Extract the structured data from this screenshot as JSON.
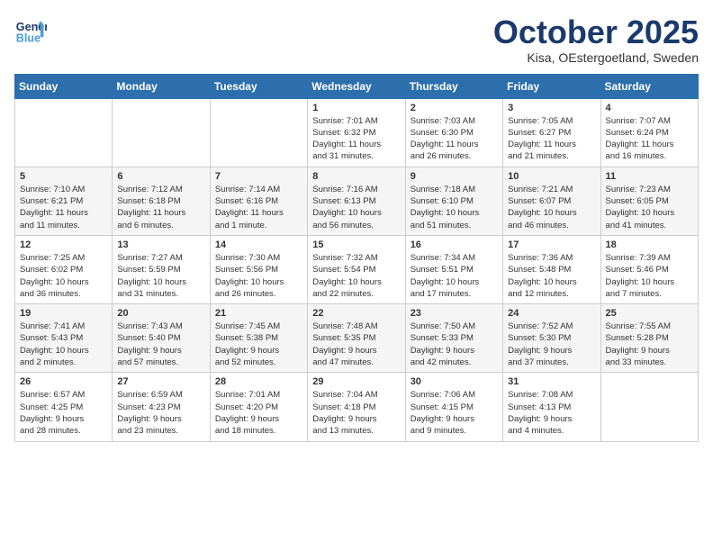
{
  "header": {
    "logo_line1": "General",
    "logo_line2": "Blue",
    "month": "October 2025",
    "location": "Kisa, OEstergoetland, Sweden"
  },
  "weekdays": [
    "Sunday",
    "Monday",
    "Tuesday",
    "Wednesday",
    "Thursday",
    "Friday",
    "Saturday"
  ],
  "weeks": [
    [
      {
        "day": "",
        "info": ""
      },
      {
        "day": "",
        "info": ""
      },
      {
        "day": "",
        "info": ""
      },
      {
        "day": "1",
        "info": "Sunrise: 7:01 AM\nSunset: 6:32 PM\nDaylight: 11 hours\nand 31 minutes."
      },
      {
        "day": "2",
        "info": "Sunrise: 7:03 AM\nSunset: 6:30 PM\nDaylight: 11 hours\nand 26 minutes."
      },
      {
        "day": "3",
        "info": "Sunrise: 7:05 AM\nSunset: 6:27 PM\nDaylight: 11 hours\nand 21 minutes."
      },
      {
        "day": "4",
        "info": "Sunrise: 7:07 AM\nSunset: 6:24 PM\nDaylight: 11 hours\nand 16 minutes."
      }
    ],
    [
      {
        "day": "5",
        "info": "Sunrise: 7:10 AM\nSunset: 6:21 PM\nDaylight: 11 hours\nand 11 minutes."
      },
      {
        "day": "6",
        "info": "Sunrise: 7:12 AM\nSunset: 6:18 PM\nDaylight: 11 hours\nand 6 minutes."
      },
      {
        "day": "7",
        "info": "Sunrise: 7:14 AM\nSunset: 6:16 PM\nDaylight: 11 hours\nand 1 minute."
      },
      {
        "day": "8",
        "info": "Sunrise: 7:16 AM\nSunset: 6:13 PM\nDaylight: 10 hours\nand 56 minutes."
      },
      {
        "day": "9",
        "info": "Sunrise: 7:18 AM\nSunset: 6:10 PM\nDaylight: 10 hours\nand 51 minutes."
      },
      {
        "day": "10",
        "info": "Sunrise: 7:21 AM\nSunset: 6:07 PM\nDaylight: 10 hours\nand 46 minutes."
      },
      {
        "day": "11",
        "info": "Sunrise: 7:23 AM\nSunset: 6:05 PM\nDaylight: 10 hours\nand 41 minutes."
      }
    ],
    [
      {
        "day": "12",
        "info": "Sunrise: 7:25 AM\nSunset: 6:02 PM\nDaylight: 10 hours\nand 36 minutes."
      },
      {
        "day": "13",
        "info": "Sunrise: 7:27 AM\nSunset: 5:59 PM\nDaylight: 10 hours\nand 31 minutes."
      },
      {
        "day": "14",
        "info": "Sunrise: 7:30 AM\nSunset: 5:56 PM\nDaylight: 10 hours\nand 26 minutes."
      },
      {
        "day": "15",
        "info": "Sunrise: 7:32 AM\nSunset: 5:54 PM\nDaylight: 10 hours\nand 22 minutes."
      },
      {
        "day": "16",
        "info": "Sunrise: 7:34 AM\nSunset: 5:51 PM\nDaylight: 10 hours\nand 17 minutes."
      },
      {
        "day": "17",
        "info": "Sunrise: 7:36 AM\nSunset: 5:48 PM\nDaylight: 10 hours\nand 12 minutes."
      },
      {
        "day": "18",
        "info": "Sunrise: 7:39 AM\nSunset: 5:46 PM\nDaylight: 10 hours\nand 7 minutes."
      }
    ],
    [
      {
        "day": "19",
        "info": "Sunrise: 7:41 AM\nSunset: 5:43 PM\nDaylight: 10 hours\nand 2 minutes."
      },
      {
        "day": "20",
        "info": "Sunrise: 7:43 AM\nSunset: 5:40 PM\nDaylight: 9 hours\nand 57 minutes."
      },
      {
        "day": "21",
        "info": "Sunrise: 7:45 AM\nSunset: 5:38 PM\nDaylight: 9 hours\nand 52 minutes."
      },
      {
        "day": "22",
        "info": "Sunrise: 7:48 AM\nSunset: 5:35 PM\nDaylight: 9 hours\nand 47 minutes."
      },
      {
        "day": "23",
        "info": "Sunrise: 7:50 AM\nSunset: 5:33 PM\nDaylight: 9 hours\nand 42 minutes."
      },
      {
        "day": "24",
        "info": "Sunrise: 7:52 AM\nSunset: 5:30 PM\nDaylight: 9 hours\nand 37 minutes."
      },
      {
        "day": "25",
        "info": "Sunrise: 7:55 AM\nSunset: 5:28 PM\nDaylight: 9 hours\nand 33 minutes."
      }
    ],
    [
      {
        "day": "26",
        "info": "Sunrise: 6:57 AM\nSunset: 4:25 PM\nDaylight: 9 hours\nand 28 minutes."
      },
      {
        "day": "27",
        "info": "Sunrise: 6:59 AM\nSunset: 4:23 PM\nDaylight: 9 hours\nand 23 minutes."
      },
      {
        "day": "28",
        "info": "Sunrise: 7:01 AM\nSunset: 4:20 PM\nDaylight: 9 hours\nand 18 minutes."
      },
      {
        "day": "29",
        "info": "Sunrise: 7:04 AM\nSunset: 4:18 PM\nDaylight: 9 hours\nand 13 minutes."
      },
      {
        "day": "30",
        "info": "Sunrise: 7:06 AM\nSunset: 4:15 PM\nDaylight: 9 hours\nand 9 minutes."
      },
      {
        "day": "31",
        "info": "Sunrise: 7:08 AM\nSunset: 4:13 PM\nDaylight: 9 hours\nand 4 minutes."
      },
      {
        "day": "",
        "info": ""
      }
    ]
  ]
}
